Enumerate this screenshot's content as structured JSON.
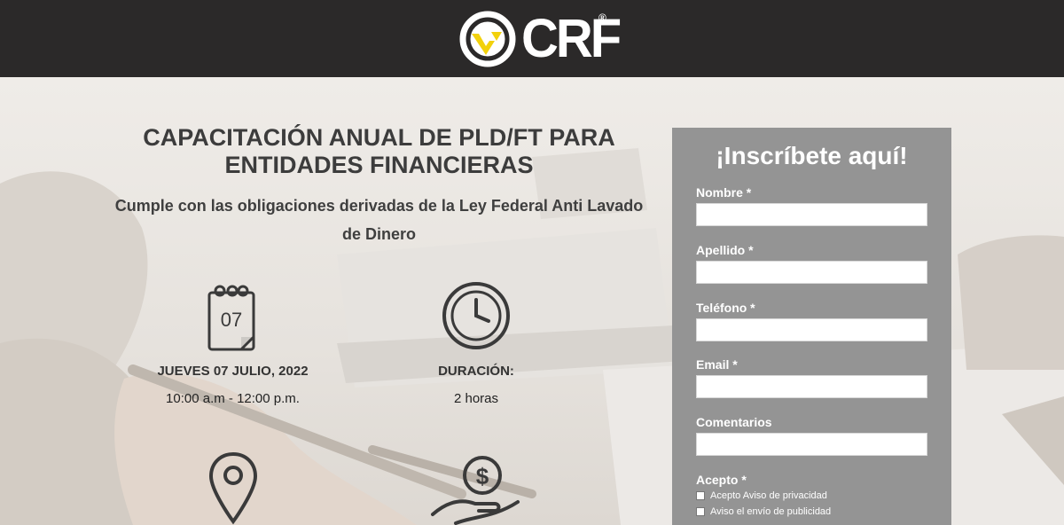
{
  "header": {
    "brand": "CRF",
    "registered": "®"
  },
  "hero": {
    "title": "CAPACITACIÓN ANUAL DE PLD/FT PARA ENTIDADES FINANCIERAS",
    "subtitle": "Cumple con las obligaciones derivadas de la Ley Federal Anti Lavado de Dinero"
  },
  "details": {
    "date": {
      "calendar_day": "07",
      "label": "JUEVES 07 JULIO, 2022",
      "value": "10:00 a.m - 12:00 p.m."
    },
    "duration": {
      "label": "DURACIÓN:",
      "value": "2 horas"
    }
  },
  "form": {
    "title": "¡Inscríbete aquí!",
    "fields": [
      {
        "label": "Nombre *",
        "value": ""
      },
      {
        "label": "Apellido *",
        "value": ""
      },
      {
        "label": "Teléfono *",
        "value": ""
      },
      {
        "label": "Email *",
        "value": ""
      },
      {
        "label": "Comentarios",
        "value": ""
      }
    ],
    "accept_label": "Acepto *",
    "checkboxes": [
      {
        "label": "Acepto Aviso de privacidad"
      },
      {
        "label": "Aviso el envío de publicidad"
      }
    ]
  },
  "colors": {
    "header_bg": "#2b2929",
    "brand_yellow": "#f2d10c",
    "panel_bg": "#949494"
  }
}
